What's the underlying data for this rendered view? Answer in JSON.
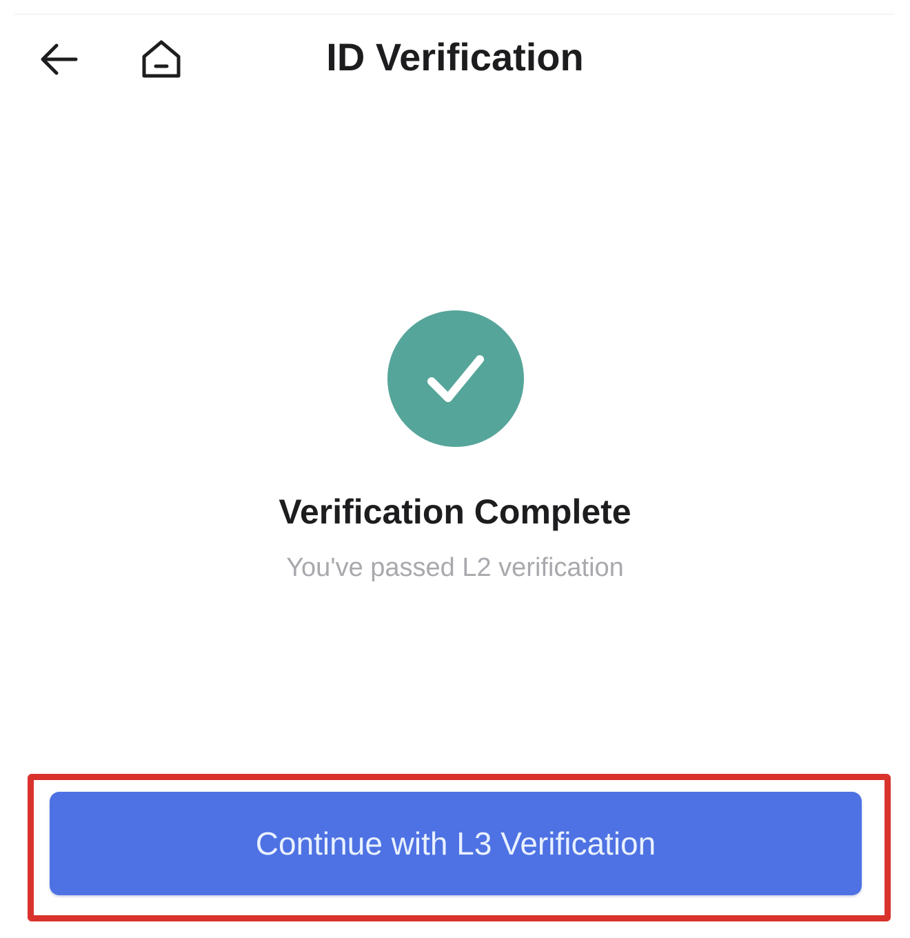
{
  "header": {
    "title": "ID Verification",
    "back_icon": "arrow-left-icon",
    "home_icon": "home-icon"
  },
  "status": {
    "icon": "checkmark-icon",
    "title": "Verification Complete",
    "subtitle": "You've passed L2 verification"
  },
  "actions": {
    "continue_label": "Continue with L3 Verification"
  },
  "colors": {
    "success": "#56a59a",
    "primary": "#4e72e3",
    "highlight": "#d9322c",
    "subtitle_text": "#a8a8ad"
  }
}
